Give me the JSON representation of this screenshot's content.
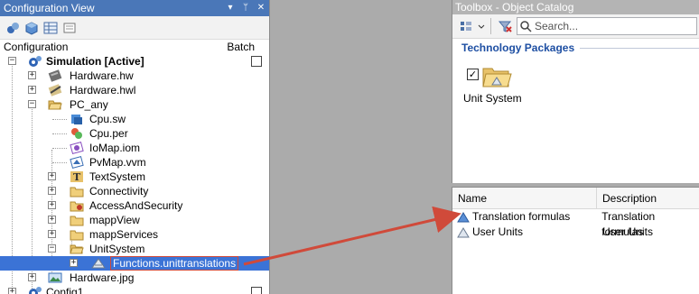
{
  "config_view": {
    "title": "Configuration View",
    "title_buttons": [
      "▾",
      "ᛘ",
      "✕"
    ],
    "column_configuration": "Configuration",
    "column_batch": "Batch",
    "tree": [
      {
        "label": "Simulation [Active]",
        "icon": "config-gear-icon",
        "expander": "−",
        "bold": true
      },
      {
        "label": "Hardware.hw",
        "icon": "hardware-icon",
        "expander": "+"
      },
      {
        "label": "Hardware.hwl",
        "icon": "hardware-list-icon",
        "expander": "+"
      },
      {
        "label": "PC_any",
        "icon": "folder-open-icon",
        "expander": "−"
      },
      {
        "label": "Cpu.sw",
        "icon": "cpu-software-icon"
      },
      {
        "label": "Cpu.per",
        "icon": "cpu-permission-icon"
      },
      {
        "label": "IoMap.iom",
        "icon": "iomap-icon"
      },
      {
        "label": "PvMap.vvm",
        "icon": "pvmap-icon"
      },
      {
        "label": "TextSystem",
        "icon": "text-system-icon",
        "expander": "+"
      },
      {
        "label": "Connectivity",
        "icon": "folder-icon",
        "expander": "+"
      },
      {
        "label": "AccessAndSecurity",
        "icon": "security-icon",
        "expander": "+"
      },
      {
        "label": "mappView",
        "icon": "folder-icon",
        "expander": "+"
      },
      {
        "label": "mappServices",
        "icon": "folder-icon",
        "expander": "+"
      },
      {
        "label": "UnitSystem",
        "icon": "folder-open-icon",
        "expander": "−"
      },
      {
        "label": "Functions.unittranslations",
        "icon": "unit-translation-icon",
        "expander": "+",
        "selected": true
      },
      {
        "label": "Hardware.jpg",
        "icon": "image-icon",
        "expander": "+"
      },
      {
        "label": "Config1",
        "icon": "config-gear-icon",
        "expander": "+"
      }
    ]
  },
  "toolbox": {
    "title": "Toolbox - Object Catalog",
    "search_placeholder": "Search...",
    "section_title": "Technology Packages",
    "package": {
      "label": "Unit System",
      "checked": true
    }
  },
  "object_list": {
    "columns": [
      "Name",
      "Description"
    ],
    "rows": [
      {
        "name": "Translation formulas",
        "description": "Translation formulas",
        "icon": "translation-formulas-icon"
      },
      {
        "name": "User Units",
        "description": "User Units",
        "icon": "user-units-icon"
      }
    ]
  },
  "colors": {
    "title_active": "#4a77b8",
    "title_inactive": "#b4b4b4",
    "selection": "#3b73d6",
    "arrow": "#d04a3a",
    "section_text": "#1e4fa3"
  }
}
